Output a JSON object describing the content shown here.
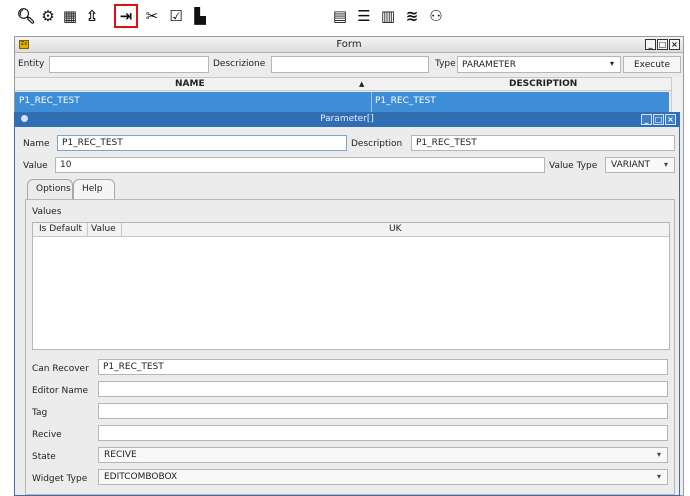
{
  "toolbar": {
    "left_icons": [
      "search-icon",
      "gear-icon",
      "chip-icon",
      "upload-icon",
      "login-icon",
      "tools-icon",
      "inbox-check-icon",
      "document-icon"
    ],
    "right_icons": [
      "id-card-icon",
      "server-icon",
      "bar-chart-icon",
      "layers-icon",
      "users-icon"
    ],
    "glyphs": {
      "search": "🔍︎",
      "gear": "⚙",
      "chip": "▦",
      "upload": "⇫",
      "login": "⇥",
      "tools": "✂",
      "inbox": "☑",
      "document": "▙",
      "idcard": "▤",
      "server": "☰",
      "chart": "▥",
      "layers": "≋",
      "users": "⚇"
    },
    "active_icon": "login-icon"
  },
  "form_window": {
    "title": "Form",
    "app_icon_text": "Zx",
    "buttons": {
      "minimize": "_",
      "maximize": "□",
      "close": "×"
    },
    "filters": {
      "entity_label": "Entity",
      "entity_value": "",
      "descrizione_label": "Descrizione",
      "descrizione_value": "",
      "type_label": "Type",
      "type_value": "PARAMETER",
      "execute_label": "Execute"
    },
    "grid": {
      "columns": [
        "NAME",
        "DESCRIPTION"
      ],
      "sort_indicator": "▲",
      "rows": [
        {
          "name": "P1_REC_TEST",
          "description": "P1_REC_TEST"
        }
      ]
    }
  },
  "parameter_window": {
    "title": "Parameter[]",
    "buttons": {
      "minimize": "_",
      "maximize": "□",
      "close": "×"
    },
    "name_label": "Name",
    "name_value": "P1_REC_TEST",
    "description_label": "Description",
    "description_value": "P1_REC_TEST",
    "value_label": "Value",
    "value_value": "10",
    "value_type_label": "Value Type",
    "value_type_value": "VARIANT",
    "tabs": [
      "Options",
      "Help"
    ],
    "selected_tab": "Options",
    "options": {
      "values_label": "Values",
      "values_columns": [
        "Is Default",
        "Value",
        "UK"
      ],
      "can_recover_label": "Can Recover",
      "can_recover_value": "P1_REC_TEST",
      "editor_name_label": "Editor Name",
      "editor_name_value": "",
      "tag_label": "Tag",
      "tag_value": "",
      "recive_label": "Recive",
      "recive_value": "",
      "state_label": "State",
      "state_value": "RECIVE",
      "widget_type_label": "Widget Type",
      "widget_type_value": "EDITCOMBOBOX"
    }
  },
  "colors": {
    "selection_blue": "#3d8ed6",
    "dialog_title_blue": "#2f6eb5",
    "active_highlight": "#e01010"
  }
}
